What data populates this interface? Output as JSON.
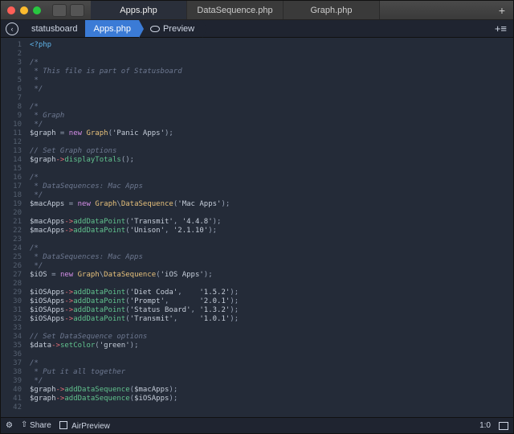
{
  "tabs": [
    {
      "label": "Apps.php",
      "active": true
    },
    {
      "label": "DataSequence.php",
      "active": false
    },
    {
      "label": "Graph.php",
      "active": false
    }
  ],
  "pathbar": {
    "project": "statusboard",
    "file": "Apps.php",
    "preview": "Preview"
  },
  "statusbar": {
    "share": "Share",
    "airpreview": "AirPreview",
    "position": "1:0"
  },
  "code": {
    "lines": [
      [
        [
          "op",
          "<?php"
        ]
      ],
      [],
      [
        [
          "cm",
          "/*"
        ]
      ],
      [
        [
          "cm",
          " * This file is part of Statusboard"
        ]
      ],
      [
        [
          "cm",
          " *"
        ]
      ],
      [
        [
          "cm",
          " */"
        ]
      ],
      [],
      [
        [
          "cm",
          "/*"
        ]
      ],
      [
        [
          "cm",
          " * Graph"
        ]
      ],
      [
        [
          "cm",
          " */"
        ]
      ],
      [
        [
          "va",
          "$graph"
        ],
        [
          "pu",
          " = "
        ],
        [
          "kw",
          "new"
        ],
        [
          "pu",
          " "
        ],
        [
          "cl",
          "Graph"
        ],
        [
          "pu",
          "("
        ],
        [
          "st",
          "'Panic Apps'"
        ],
        [
          "pu",
          ");"
        ]
      ],
      [],
      [
        [
          "cm",
          "// Set Graph options"
        ]
      ],
      [
        [
          "va",
          "$graph"
        ],
        [
          "ar",
          "->"
        ],
        [
          "mt",
          "displayTotals"
        ],
        [
          "pu",
          "();"
        ]
      ],
      [],
      [
        [
          "cm",
          "/*"
        ]
      ],
      [
        [
          "cm",
          " * DataSequences: Mac Apps"
        ]
      ],
      [
        [
          "cm",
          " */"
        ]
      ],
      [
        [
          "va",
          "$macApps"
        ],
        [
          "pu",
          " = "
        ],
        [
          "kw",
          "new"
        ],
        [
          "pu",
          " "
        ],
        [
          "cl",
          "Graph"
        ],
        [
          "pu",
          "\\"
        ],
        [
          "cl",
          "DataSequence"
        ],
        [
          "pu",
          "("
        ],
        [
          "st",
          "'Mac Apps'"
        ],
        [
          "pu",
          ");"
        ]
      ],
      [],
      [
        [
          "va",
          "$macApps"
        ],
        [
          "ar",
          "->"
        ],
        [
          "mt",
          "addDataPoint"
        ],
        [
          "pu",
          "("
        ],
        [
          "st",
          "'Transmit'"
        ],
        [
          "pu",
          ", "
        ],
        [
          "st",
          "'4.4.8'"
        ],
        [
          "pu",
          ");"
        ]
      ],
      [
        [
          "va",
          "$macApps"
        ],
        [
          "ar",
          "->"
        ],
        [
          "mt",
          "addDataPoint"
        ],
        [
          "pu",
          "("
        ],
        [
          "st",
          "'Unison'"
        ],
        [
          "pu",
          ", "
        ],
        [
          "st",
          "'2.1.10'"
        ],
        [
          "pu",
          ");"
        ]
      ],
      [],
      [
        [
          "cm",
          "/*"
        ]
      ],
      [
        [
          "cm",
          " * DataSequences: Mac Apps"
        ]
      ],
      [
        [
          "cm",
          " */"
        ]
      ],
      [
        [
          "va",
          "$iOS"
        ],
        [
          "pu",
          " = "
        ],
        [
          "kw",
          "new"
        ],
        [
          "pu",
          " "
        ],
        [
          "cl",
          "Graph"
        ],
        [
          "pu",
          "\\"
        ],
        [
          "cl",
          "DataSequence"
        ],
        [
          "pu",
          "("
        ],
        [
          "st",
          "'iOS Apps'"
        ],
        [
          "pu",
          ");"
        ]
      ],
      [],
      [
        [
          "va",
          "$iOSApps"
        ],
        [
          "ar",
          "->"
        ],
        [
          "mt",
          "addDataPoint"
        ],
        [
          "pu",
          "("
        ],
        [
          "st",
          "'Diet Coda'"
        ],
        [
          "pu",
          ",    "
        ],
        [
          "st",
          "'1.5.2'"
        ],
        [
          "pu",
          ");"
        ]
      ],
      [
        [
          "va",
          "$iOSApps"
        ],
        [
          "ar",
          "->"
        ],
        [
          "mt",
          "addDataPoint"
        ],
        [
          "pu",
          "("
        ],
        [
          "st",
          "'Prompt'"
        ],
        [
          "pu",
          ",       "
        ],
        [
          "st",
          "'2.0.1'"
        ],
        [
          "pu",
          ");"
        ]
      ],
      [
        [
          "va",
          "$iOSApps"
        ],
        [
          "ar",
          "->"
        ],
        [
          "mt",
          "addDataPoint"
        ],
        [
          "pu",
          "("
        ],
        [
          "st",
          "'Status Board'"
        ],
        [
          "pu",
          ", "
        ],
        [
          "st",
          "'1.3.2'"
        ],
        [
          "pu",
          ");"
        ]
      ],
      [
        [
          "va",
          "$iOSApps"
        ],
        [
          "ar",
          "->"
        ],
        [
          "mt",
          "addDataPoint"
        ],
        [
          "pu",
          "("
        ],
        [
          "st",
          "'Transmit'"
        ],
        [
          "pu",
          ",     "
        ],
        [
          "st",
          "'1.0.1'"
        ],
        [
          "pu",
          ");"
        ]
      ],
      [],
      [
        [
          "cm",
          "// Set DataSequence options"
        ]
      ],
      [
        [
          "va",
          "$data"
        ],
        [
          "ar",
          "->"
        ],
        [
          "mt",
          "setColor"
        ],
        [
          "pu",
          "("
        ],
        [
          "st",
          "'green'"
        ],
        [
          "pu",
          ");"
        ]
      ],
      [],
      [
        [
          "cm",
          "/*"
        ]
      ],
      [
        [
          "cm",
          " * Put it all together"
        ]
      ],
      [
        [
          "cm",
          " */"
        ]
      ],
      [
        [
          "va",
          "$graph"
        ],
        [
          "ar",
          "->"
        ],
        [
          "mt",
          "addDataSequence"
        ],
        [
          "pu",
          "("
        ],
        [
          "va",
          "$macApps"
        ],
        [
          "pu",
          ");"
        ]
      ],
      [
        [
          "va",
          "$graph"
        ],
        [
          "ar",
          "->"
        ],
        [
          "mt",
          "addDataSequence"
        ],
        [
          "pu",
          "("
        ],
        [
          "va",
          "$iOSApps"
        ],
        [
          "pu",
          ");"
        ]
      ],
      []
    ]
  }
}
